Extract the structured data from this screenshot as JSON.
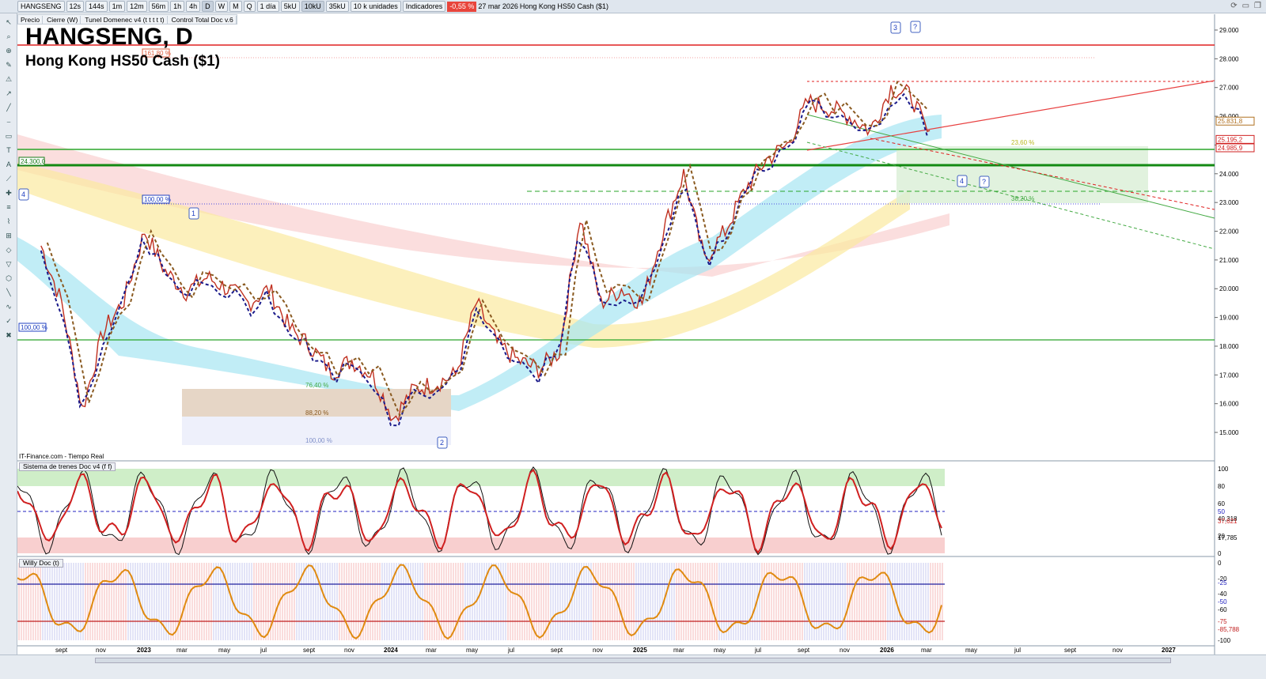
{
  "toolbar": {
    "symbol": "HANGSENG",
    "intervals": [
      "12s",
      "144s",
      "1m",
      "12m",
      "56m",
      "1h",
      "4h",
      "D",
      "W",
      "M",
      "Q"
    ],
    "period": "1 día",
    "units_buttons": [
      "5kU",
      "10kU",
      "35kU"
    ],
    "units": "10 k unidades",
    "indicators": "Indicadores",
    "change": "-0,55 %",
    "date": "27 mar 2026",
    "instrument": "Hong Kong HS50 Cash ($1)"
  },
  "layers": [
    "Precio",
    "Cierre (W)",
    "Tunel Domenec v4 (t t t t t)",
    "Control Total Doc v.6"
  ],
  "chart": {
    "title": "HANGSENG, D",
    "subtitle": "Hong Kong HS50 Cash ($1)",
    "source": "IT-Finance.com - Tiempo Real",
    "labels": {
      "fib161": "161,80 %",
      "fib100a": "100,00 %",
      "fib100b": "100,00 %",
      "level24300": "24.300,0",
      "fib764": "76,40 %",
      "fib882": "88,20 %",
      "fib100c": "100,00 %",
      "fib236": "23,60 %",
      "fib382": "38,20 %",
      "w1": "1",
      "w2": "2",
      "w3": "3",
      "w4a": "4",
      "w4b": "4",
      "q1": "?",
      "q2": "?"
    },
    "price_ticks": [
      "29.000",
      "28.000",
      "27.000",
      "26.000",
      "25.000",
      "24.000",
      "23.000",
      "22.000",
      "21.000",
      "20.000",
      "19.000",
      "18.000",
      "17.000",
      "16.000",
      "15.000"
    ],
    "price_tags": {
      "orange": "25.831,8",
      "red1": "25.195,2",
      "red2": "24.985,9"
    },
    "date_ticks": [
      "sept",
      "nov",
      "2023",
      "mar",
      "may",
      "jul",
      "sept",
      "nov",
      "2024",
      "mar",
      "may",
      "jul",
      "sept",
      "nov",
      "2025",
      "mar",
      "may",
      "jul",
      "sept",
      "nov",
      "2026",
      "mar",
      "may",
      "jul",
      "sept",
      "nov",
      "2027"
    ]
  },
  "chart_data": {
    "type": "line",
    "x": [
      "ago22",
      "sep22",
      "oct22",
      "nov22",
      "dic22",
      "ene23",
      "feb23",
      "mar23",
      "abr23",
      "may23",
      "jun23",
      "jul23",
      "ago23",
      "sep23",
      "oct23",
      "nov23",
      "dic23",
      "ene24",
      "feb24",
      "mar24",
      "abr24",
      "may24",
      "jun24",
      "jul24",
      "ago24",
      "sep24",
      "oct24",
      "nov24",
      "dic24",
      "ene25",
      "feb25",
      "mar25",
      "abr25",
      "may25",
      "jun25",
      "jul25",
      "ago25",
      "sep25",
      "oct25",
      "nov25",
      "dic25",
      "ene26",
      "feb26",
      "mar26"
    ],
    "values": [
      21500,
      19500,
      15800,
      18500,
      19600,
      22000,
      20600,
      19900,
      20400,
      20000,
      19500,
      20000,
      18600,
      18000,
      17100,
      17500,
      17000,
      15500,
      16500,
      16700,
      17000,
      19500,
      18100,
      17500,
      17200,
      17800,
      22500,
      19500,
      20000,
      19500,
      22000,
      24000,
      21000,
      22000,
      23500,
      24500,
      25000,
      26500,
      26300,
      26000,
      25500,
      27000,
      26700,
      25000
    ],
    "ylim": [
      14500,
      29500
    ]
  },
  "indicator1": {
    "title": "Sistema de trenes Doc v4 (f f)",
    "ticks": [
      "100",
      "80",
      "60",
      "50",
      "40,318",
      "37,621",
      "20",
      "17,785",
      "0"
    ]
  },
  "indicator2": {
    "title": "Willy Doc (t)",
    "ticks": [
      "0",
      "-20",
      "-25",
      "-40",
      "-50",
      "-60",
      "-75",
      "-85,788",
      "-100"
    ]
  }
}
